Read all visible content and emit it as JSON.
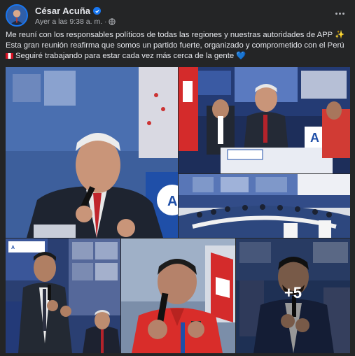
{
  "post": {
    "author": "César Acuña",
    "timestamp": "Ayer a las 9:38 a. m.",
    "separator": "·",
    "audience_icon": "globe-icon",
    "verified_icon": "verified-badge-icon",
    "more_icon": "more-options-icon",
    "text": {
      "line1": "Me reuní con los responsables políticos de todas las regiones y nuestras autoridades de APP",
      "line1_emoji": "✨",
      "line2": "Esta gran reunión reafirma que somos un partido fuerte, organizado y comprometido con el Perú",
      "line3_flag": "peru-flag-icon",
      "line3": "Seguiré trabajando para estar cada vez más cerca de la gente",
      "line3_emoji": "💙"
    },
    "gallery": {
      "more_count": "+5"
    }
  },
  "colors": {
    "background": "#242526",
    "text_primary": "#e4e6eb",
    "text_secondary": "#b0b3b8",
    "verified_blue": "#1877f2"
  }
}
